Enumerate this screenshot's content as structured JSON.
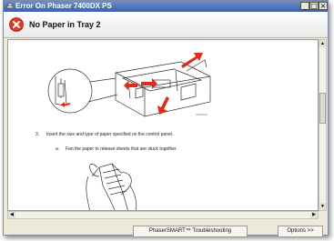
{
  "window": {
    "title": "Error On Phaser 7400DX PS",
    "controls": {
      "minimize": "_",
      "maximize": "□",
      "close": "×"
    }
  },
  "header": {
    "title": "No Paper in Tray 2",
    "icon": "error-icon"
  },
  "content": {
    "figure_label": "7400-010",
    "step": {
      "number": "3.",
      "text": "Insert the size and type of paper specified on the control panel."
    },
    "substep": {
      "letter": "a.",
      "text": "Fan the paper to release sheets that are stuck together."
    }
  },
  "buttons": {
    "troubleshooting": "PhaserSMART™ Troubleshooting",
    "options": "Options >>"
  },
  "colors": {
    "title_bar": "#3c62a8",
    "error_red": "#d93b26",
    "arrow_red": "#e02a1a"
  }
}
